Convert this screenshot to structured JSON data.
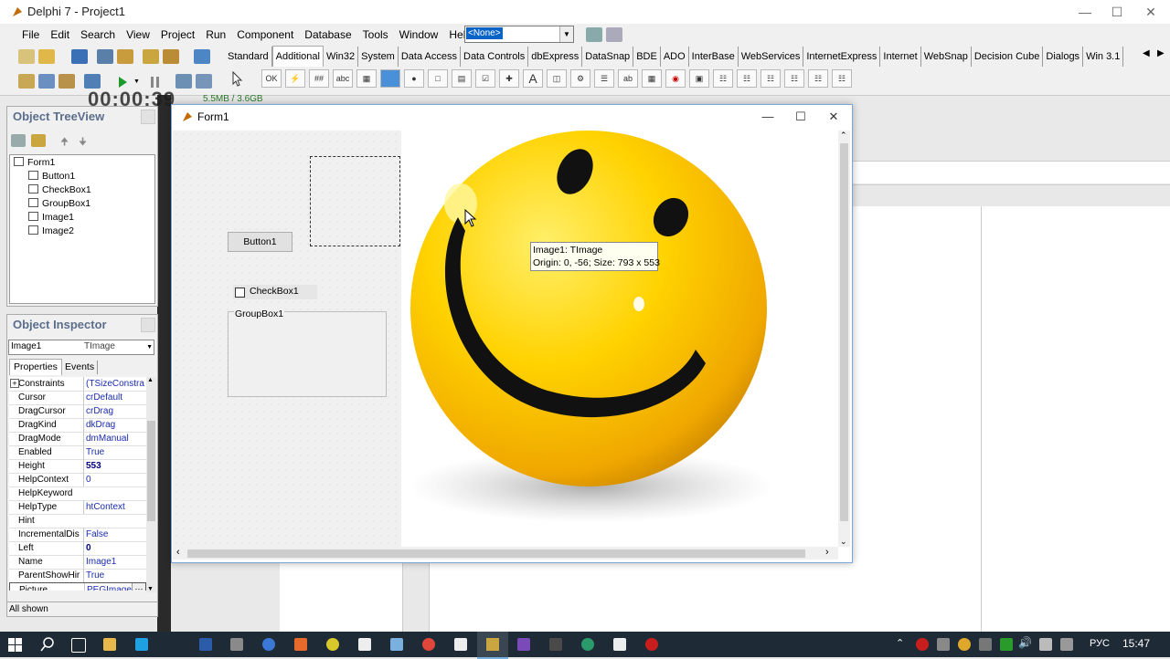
{
  "ide": {
    "title": "Delphi 7 - Project1",
    "menu": [
      "File",
      "Edit",
      "Search",
      "View",
      "Project",
      "Run",
      "Component",
      "Database",
      "Tools",
      "Window",
      "Help"
    ],
    "config_combo": "<None>",
    "palette_tabs": [
      "Standard",
      "Additional",
      "Win32",
      "System",
      "Data Access",
      "Data Controls",
      "dbExpress",
      "DataSnap",
      "BDE",
      "ADO",
      "InterBase",
      "WebServices",
      "InternetExpress",
      "Internet",
      "WebSnap",
      "Decision Cube",
      "Dialogs",
      "Win 3.1"
    ],
    "active_palette_tab": "Additional",
    "background_overlay": {
      "timer": "00:00:39",
      "mem": "5.5MB / 3.6GB"
    }
  },
  "tree_view": {
    "title": "Object TreeView",
    "nodes": [
      "Form1",
      "Button1",
      "CheckBox1",
      "GroupBox1",
      "Image1",
      "Image2"
    ]
  },
  "inspector": {
    "title": "Object Inspector",
    "selected_name": "Image1",
    "selected_type": "TImage",
    "tabs": [
      "Properties",
      "Events"
    ],
    "properties": [
      {
        "k": "Constraints",
        "v": "(TSizeConstra"
      },
      {
        "k": "Cursor",
        "v": "crDefault"
      },
      {
        "k": "DragCursor",
        "v": "crDrag"
      },
      {
        "k": "DragKind",
        "v": "dkDrag"
      },
      {
        "k": "DragMode",
        "v": "dmManual"
      },
      {
        "k": "Enabled",
        "v": "True"
      },
      {
        "k": "Height",
        "v": "553"
      },
      {
        "k": "HelpContext",
        "v": "0"
      },
      {
        "k": "HelpKeyword",
        "v": ""
      },
      {
        "k": "HelpType",
        "v": "htContext"
      },
      {
        "k": "Hint",
        "v": ""
      },
      {
        "k": "IncrementalDis",
        "v": "False"
      },
      {
        "k": "Left",
        "v": "0"
      },
      {
        "k": "Name",
        "v": "Image1"
      },
      {
        "k": "ParentShowHir",
        "v": "True"
      },
      {
        "k": "Picture",
        "v": "PEGImage)"
      }
    ],
    "status": "All shown"
  },
  "form": {
    "title": "Form1",
    "button": "Button1",
    "checkbox": "CheckBox1",
    "groupbox": "GroupBox1",
    "tooltip_line1": "Image1: TImage",
    "tooltip_line2": "Origin: 0, -56; Size: 793 x 553"
  },
  "taskbar": {
    "lang": "РУС",
    "time": "15:47"
  }
}
